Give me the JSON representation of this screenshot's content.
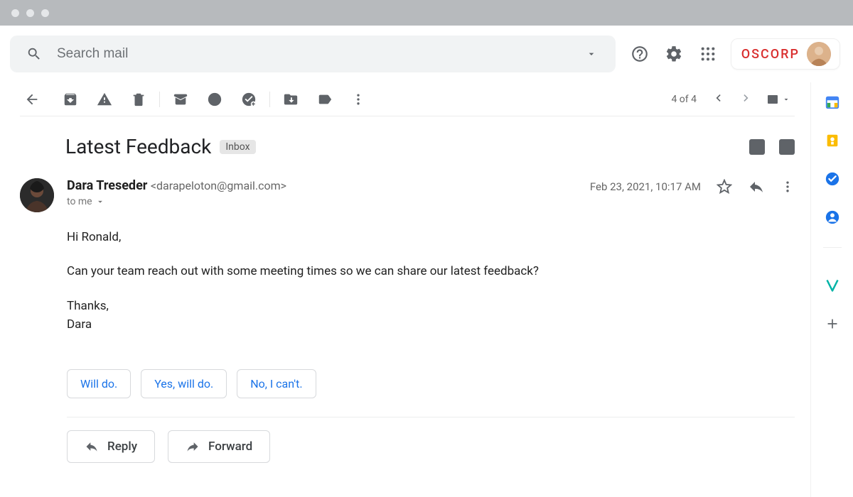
{
  "search": {
    "placeholder": "Search mail"
  },
  "brand": {
    "name": "OSCORP"
  },
  "toolbar": {
    "count_text": "4 of 4"
  },
  "subject": {
    "title": "Latest Feedback",
    "folder": "Inbox"
  },
  "sender": {
    "name": "Dara Treseder",
    "email": "<darapeloton@gmail.com>",
    "recipient": "to me"
  },
  "message": {
    "timestamp": "Feb 23, 2021, 10:17 AM",
    "greeting": "Hi Ronald,",
    "line1": "Can your team reach out with some meeting times so we can share our latest feedback?",
    "thanks": "Thanks,",
    "signature": "Dara"
  },
  "smart_replies": {
    "a": "Will do.",
    "b": "Yes, will do.",
    "c": "No, I can't."
  },
  "actions": {
    "reply": "Reply",
    "forward": "Forward"
  }
}
